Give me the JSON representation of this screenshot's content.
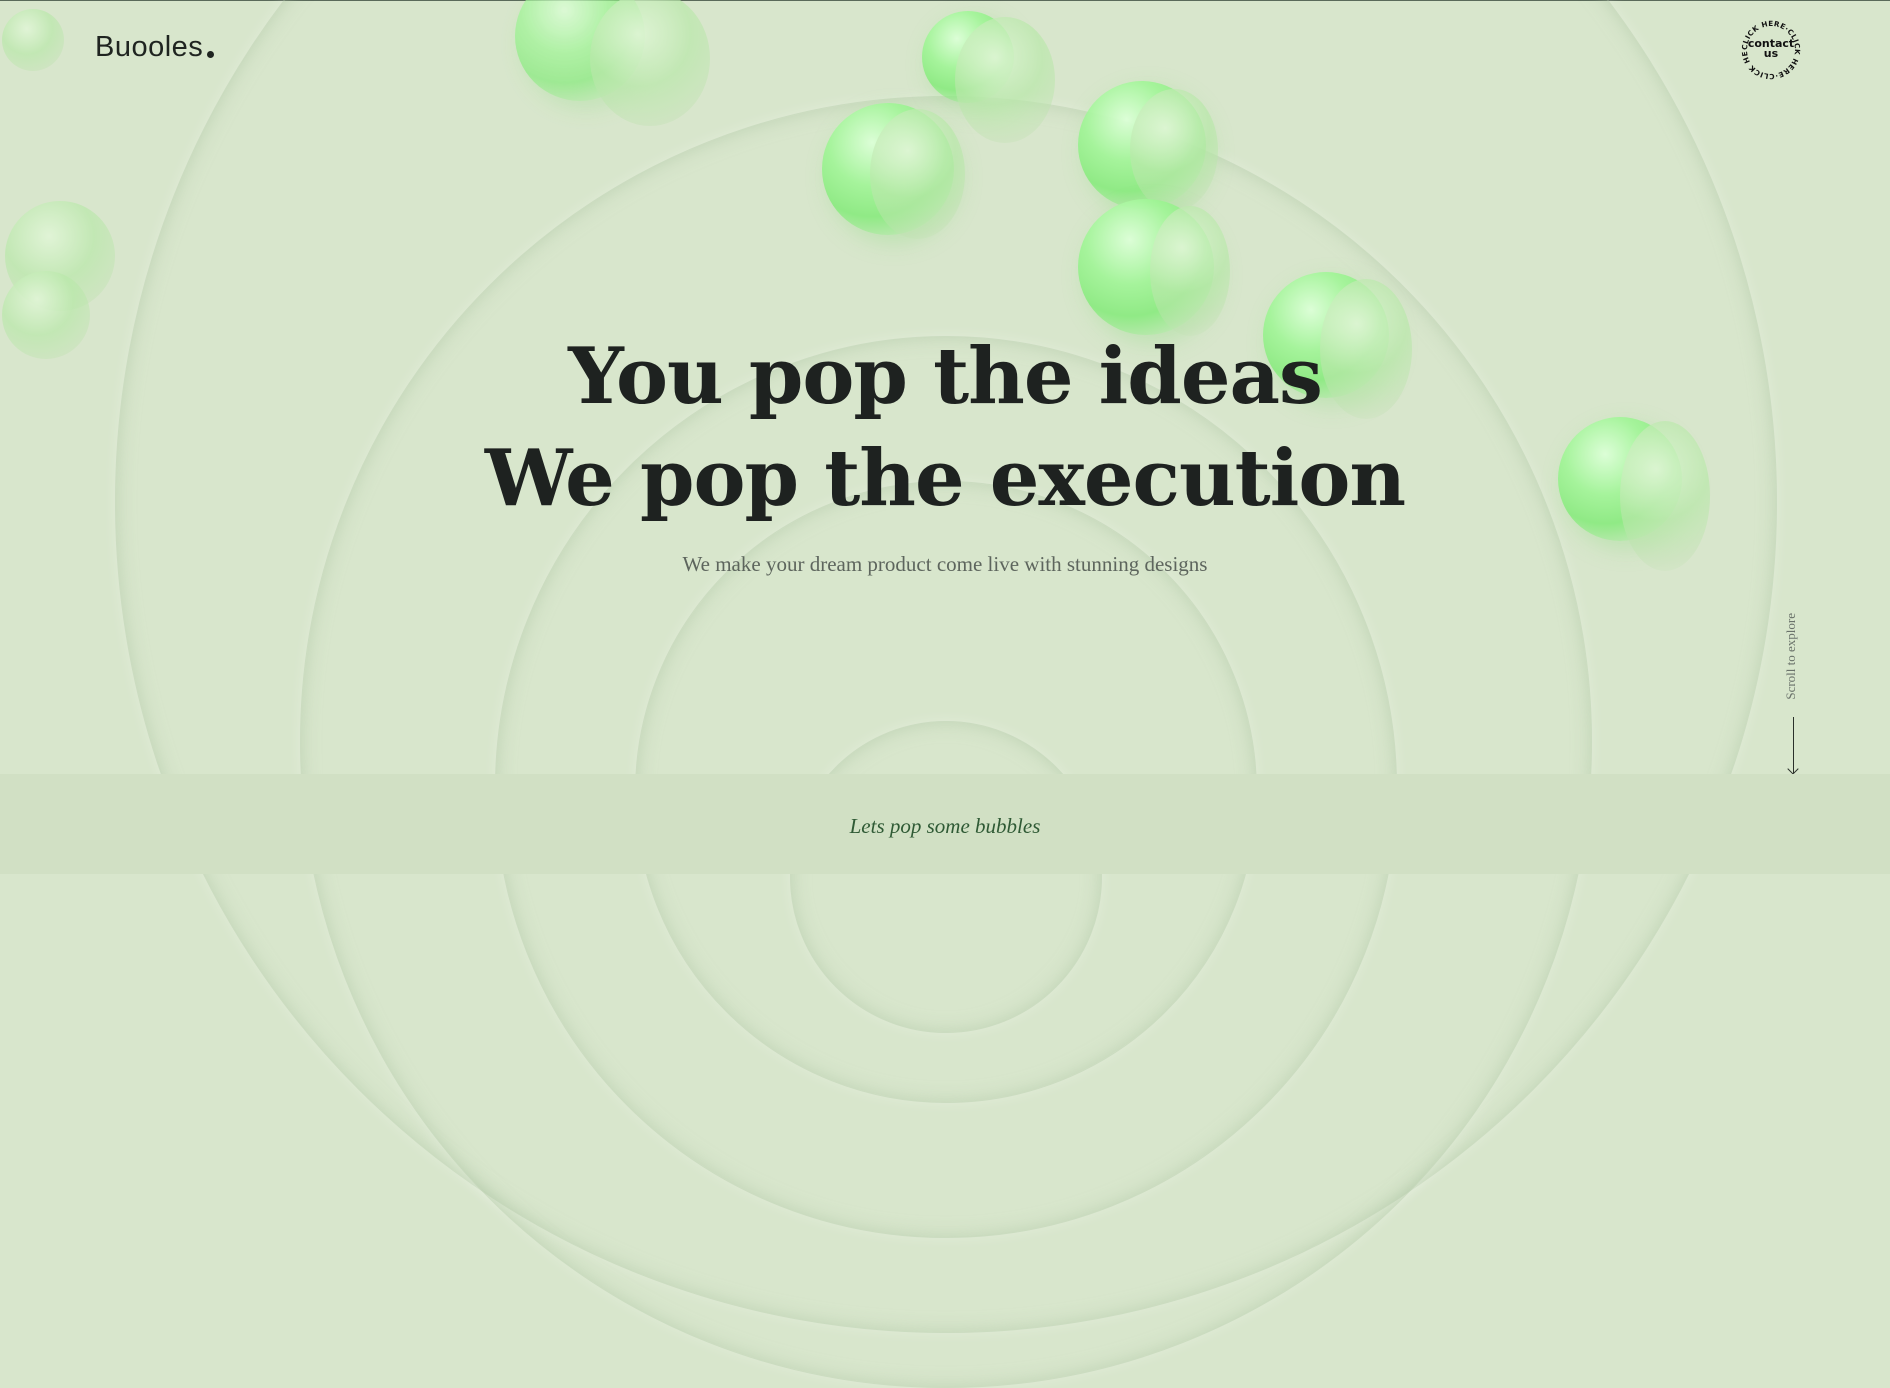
{
  "header": {
    "logo_text": "Buooles",
    "contact": {
      "label": "contact us",
      "ring_text": "CLICK HERE·CLICK HERE·CLICK HERE·"
    }
  },
  "hero": {
    "line1": "You pop the ideas",
    "line2": "We pop the execution",
    "subtitle": "We make your dream product come live with stunning designs"
  },
  "scroll_hint": {
    "label": "Scroll to explore",
    "icon": "arrow-down-icon"
  },
  "footer": {
    "tagline": "Lets pop some bubbles"
  },
  "colors": {
    "background": "#d8e6cc",
    "band": "#d1e0c4",
    "text_dark": "#1e2220",
    "bubble_green": "#7ce870",
    "tagline_green": "#2f5a35"
  }
}
